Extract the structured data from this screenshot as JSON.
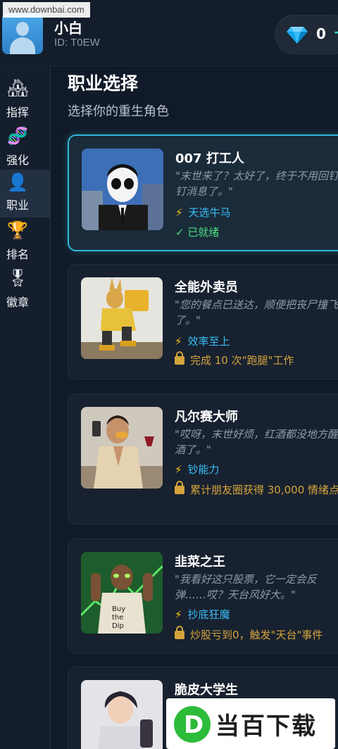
{
  "watermark": "www.downbai.com",
  "user": {
    "name": "小白",
    "id": "ID: T0EW"
  },
  "currency": {
    "icon": "diamond-icon",
    "count": "0",
    "add_label": "+"
  },
  "sidebar": {
    "items": [
      {
        "label": "指挥",
        "icon": "house-icon",
        "glyph": "🏘"
      },
      {
        "label": "强化",
        "icon": "dna-icon",
        "glyph": "🧬"
      },
      {
        "label": "职业",
        "icon": "person-icon",
        "glyph": "👤"
      },
      {
        "label": "排名",
        "icon": "trophy-icon",
        "glyph": "🏆"
      },
      {
        "label": "徽章",
        "icon": "medal-icon",
        "glyph": "🎖"
      }
    ]
  },
  "main": {
    "title": "职业选择",
    "subtitle": "选择你的重生角色",
    "cards": [
      {
        "title": "007 打工人",
        "quote": "\"末世来了？太好了，终于不用回钉钉消息了。\"",
        "skill": "天选牛马",
        "status": "已就绪",
        "status_type": "ready",
        "portrait": "portrait-office-worker"
      },
      {
        "title": "全能外卖员",
        "quote": "\"您的餐点已送达，顺便把丧尸撞飞了。\"",
        "skill": "效率至上",
        "status": "完成 10 次\"跑腿\"工作",
        "status_type": "locked",
        "portrait": "portrait-delivery-rider"
      },
      {
        "title": "凡尔赛大师",
        "quote": "\"哎呀，末世好烦，红酒都没地方醒酒了。\"",
        "skill": "钞能力",
        "status": "累计朋友圈获得 30,000 情绪点",
        "status_type": "locked",
        "portrait": "portrait-rich-man"
      },
      {
        "title": "韭菜之王",
        "quote": "\"我看好这只股票，它一定会反弹……哎？天台风好大。\"",
        "skill": "抄底狂魔",
        "status": "炒股亏到0，触发\"天台\"事件",
        "status_type": "locked",
        "portrait": "portrait-stock-trader"
      },
      {
        "title": "脆皮大学生",
        "quote": "",
        "skill": "",
        "status": "",
        "status_type": "locked",
        "portrait": "portrait-student"
      }
    ]
  },
  "brand": {
    "name": "当百下载",
    "logo_letter": "D"
  },
  "colors": {
    "accent": "#2fb7d9",
    "ready": "#4ade80",
    "locked": "#d4a43c",
    "skill": "#38bdf8"
  }
}
